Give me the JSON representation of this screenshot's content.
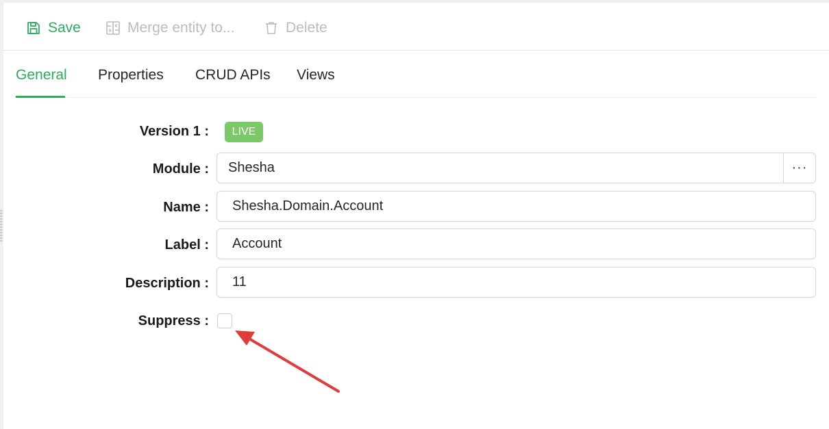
{
  "toolbar": {
    "save_label": "Save",
    "merge_label": "Merge entity to...",
    "delete_label": "Delete"
  },
  "tabs": [
    {
      "label": "General",
      "active": true
    },
    {
      "label": "Properties",
      "active": false
    },
    {
      "label": "CRUD APIs",
      "active": false
    },
    {
      "label": "Views",
      "active": false
    }
  ],
  "form": {
    "version_label": "Version 1 :",
    "version_status": "LIVE",
    "module_label": "Module :",
    "module_value": "Shesha",
    "module_button": "···",
    "name_label": "Name :",
    "name_value": "Shesha.Domain.Account",
    "label_label": "Label :",
    "label_value": "Account",
    "description_label": "Description :",
    "description_value": "11",
    "suppress_label": "Suppress :",
    "suppress_checked": false
  },
  "colors": {
    "accent": "#2eab5e",
    "live_badge": "#7cc96a",
    "annotation_arrow": "#e03c3c",
    "disabled": "#bcbcbc"
  },
  "icons": {
    "save": "save-icon",
    "merge": "merge-icon",
    "delete": "trash-icon"
  }
}
